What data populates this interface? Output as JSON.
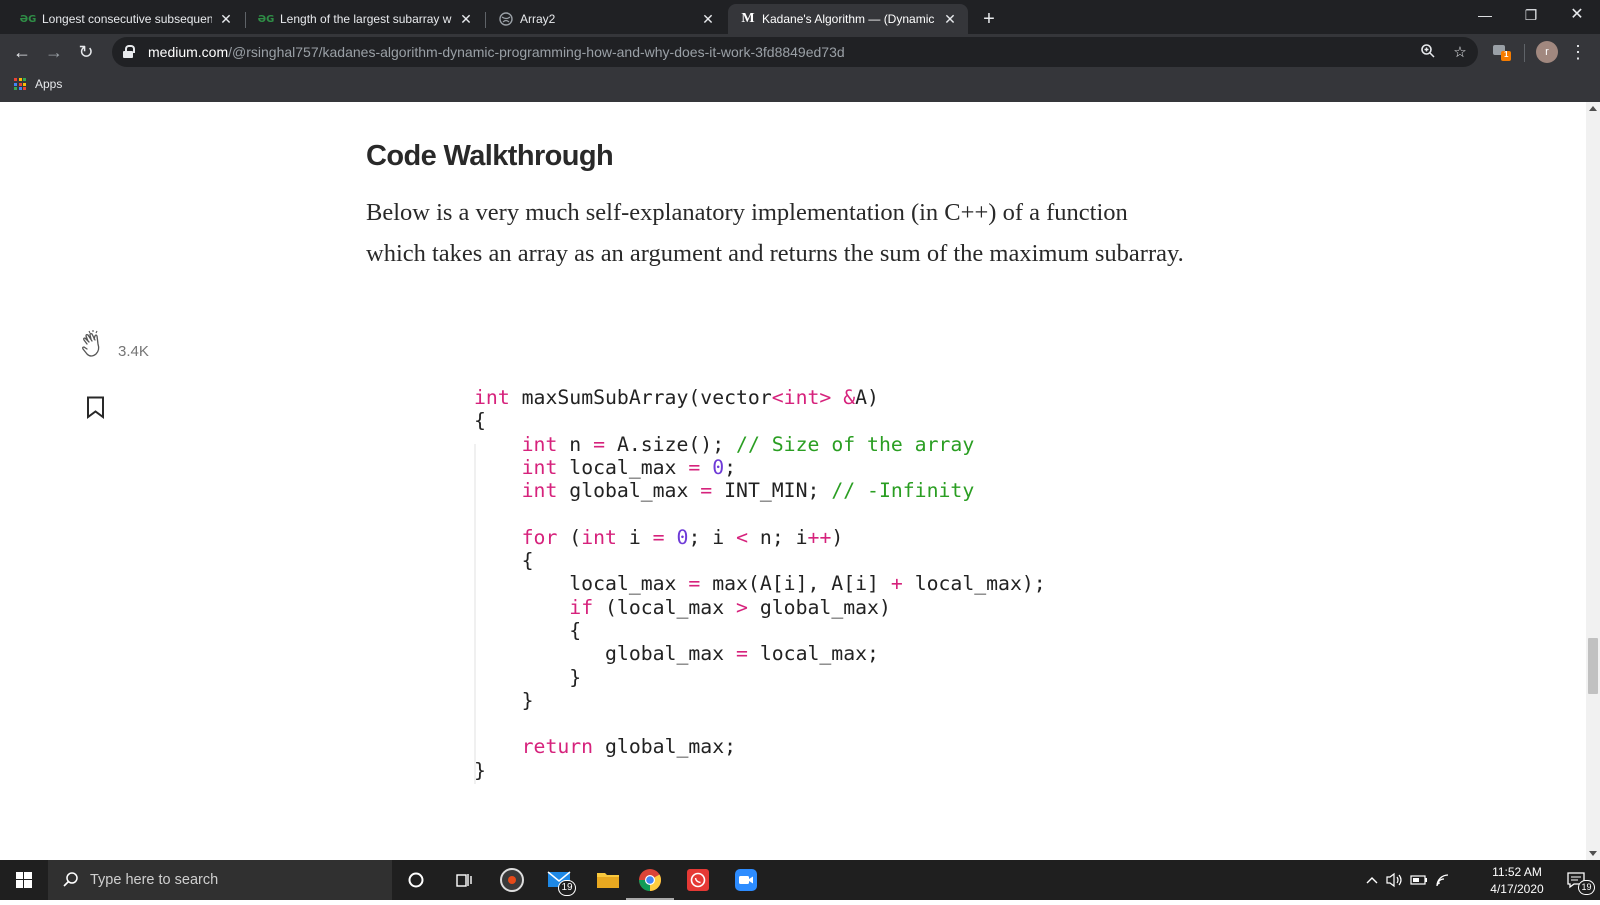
{
  "browser": {
    "tabs": [
      {
        "title": "Longest consecutive subsequenc",
        "favicon": "GfG",
        "active": false
      },
      {
        "title": "Length of the largest subarray wi",
        "favicon": "GfG",
        "active": false
      },
      {
        "title": "Array2",
        "favicon": "globe",
        "active": false
      },
      {
        "title": "Kadane's Algorithm — (Dynamic",
        "favicon": "M",
        "active": true
      }
    ],
    "url_host": "medium.com",
    "url_path": "/@rsinghal757/kadanes-algorithm-dynamic-programming-how-and-why-does-it-work-3fd8849ed73d",
    "bookmarks_apps_label": "Apps",
    "profile_initial": "r",
    "extension_badge": "1",
    "colors": {
      "accent_gfg": "#2f8d46",
      "chrome_dark": "#202124",
      "chrome_toolbar": "#35363a"
    }
  },
  "article": {
    "heading": "Code Walkthrough",
    "paragraph": "Below is a very much self-explanatory implementation (in C++) of a function which takes an array as an argument and returns the sum of the maximum subarray.",
    "clap_count": "3.4K",
    "code_lines": [
      "int maxSumSubArray(vector<int> &A)",
      "{",
      "    int n = A.size(); // Size of the array",
      "    int local_max = 0;",
      "    int global_max = INT_MIN; // -Infinity",
      "",
      "    for (int i = 0; i < n; i++)",
      "    {",
      "        local_max = max(A[i], A[i] + local_max);",
      "        if (local_max > global_max)",
      "        {",
      "           global_max = local_max;",
      "        }",
      "    }",
      "",
      "    return global_max;",
      "}"
    ]
  },
  "taskbar": {
    "search_placeholder": "Type here to search",
    "mail_badge": "19",
    "time": "11:52 AM",
    "date": "4/17/2020",
    "notification_count": "19"
  }
}
